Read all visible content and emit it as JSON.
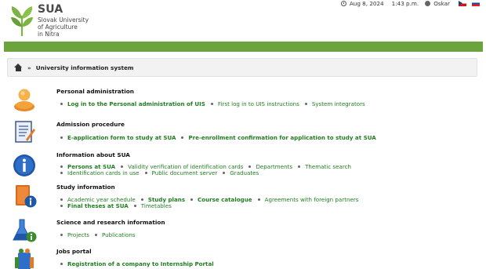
{
  "brand": {
    "abbr": "SUA",
    "full_line1": "Slovak University",
    "full_line2": "of Agriculture",
    "full_line3": "in Nitra"
  },
  "topbar": {
    "date": "Aug 8, 2024",
    "time": "1:43 p.m.",
    "user": "Oskar"
  },
  "breadcrumb": {
    "sep": "»",
    "current": "University information system"
  },
  "sections": {
    "personal": {
      "title": "Personal administration",
      "links": [
        "Log in to the Personal administration of UIS",
        "First log in to UIS instructions",
        "System integrators"
      ]
    },
    "admission": {
      "title": "Admission procedure",
      "links": [
        "E-application form to study at SUA",
        "Pre-enrollment confirmation for application to study at SUA"
      ]
    },
    "info": {
      "title": "Information about SUA",
      "links": [
        "Persons at SUA",
        "Validity verification of identification cards",
        "Departments",
        "Thematic search",
        "Identification cards in use",
        "Public document server",
        "Graduates"
      ]
    },
    "study": {
      "title": "Study information",
      "links": [
        "Academic year schedule",
        "Study plans",
        "Course catalogue",
        "Agreements with foreign partners",
        "Final theses at SUA",
        "Timetables"
      ]
    },
    "science": {
      "title": "Science and research information",
      "links": [
        "Projects",
        "Publications"
      ]
    },
    "jobs": {
      "title": "Jobs portal",
      "links": [
        "Registration of a company to Internship Portal"
      ]
    }
  },
  "colors": {
    "green_bar": "#6ba43c",
    "link": "#1f7f1f"
  }
}
